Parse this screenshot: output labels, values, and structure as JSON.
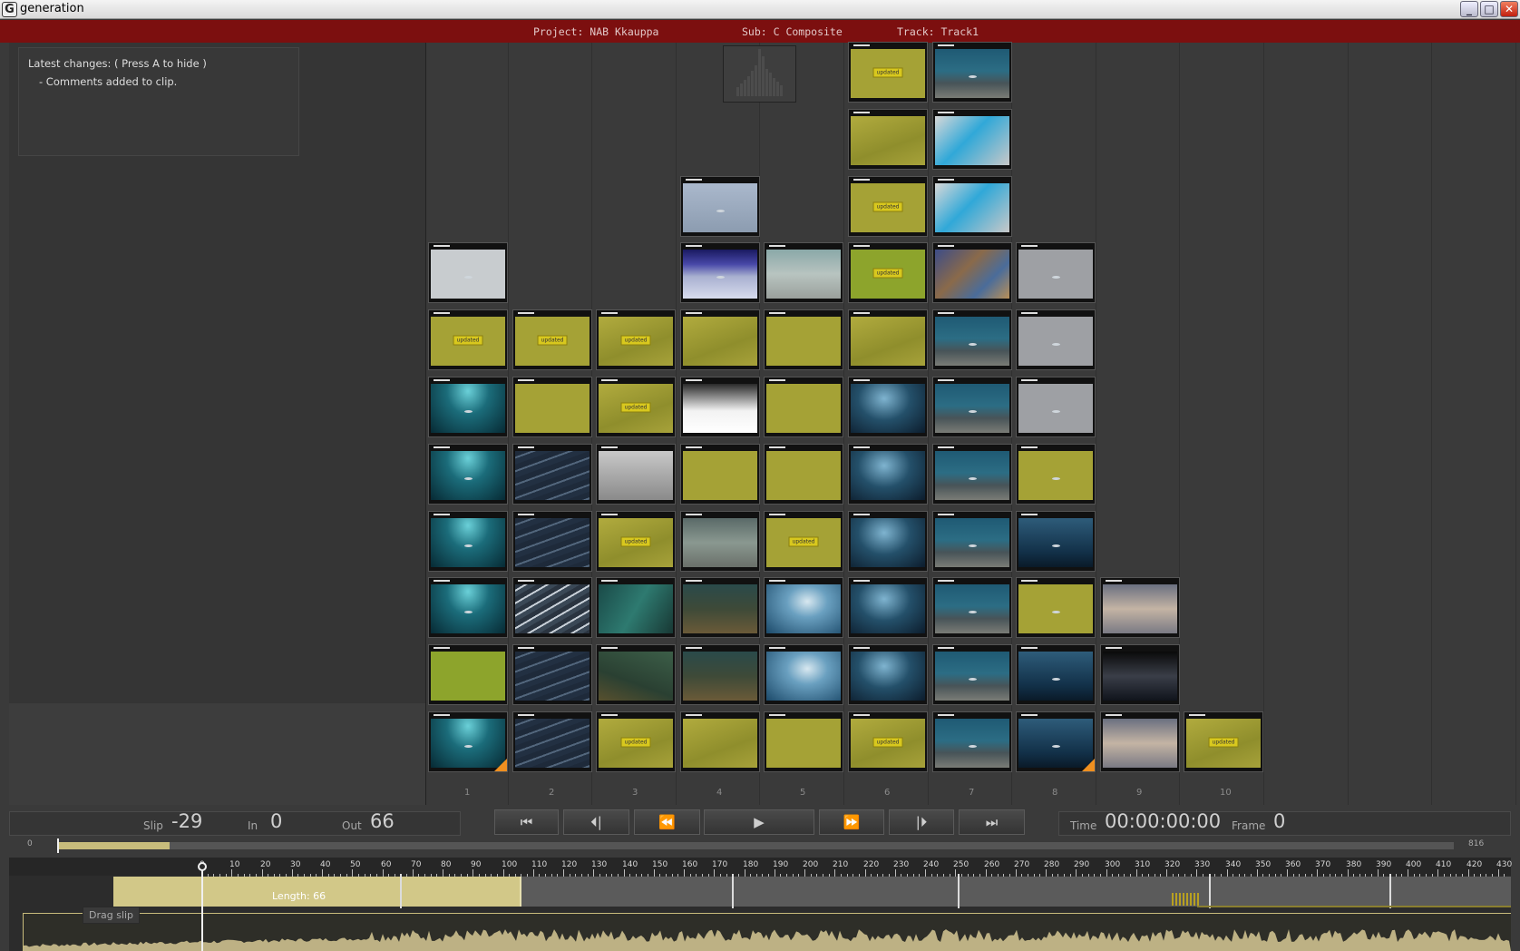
{
  "window": {
    "title": "generation",
    "app_icon": "G",
    "controls": [
      "_",
      "□",
      "✕"
    ]
  },
  "infobar": {
    "project": "Project: NAB Kkauppa",
    "sub": "Sub: C Composite",
    "track": "Track: Track1"
  },
  "changes": {
    "title": "Latest changes: ( Press A to hide )",
    "item": "- Comments added to clip."
  },
  "columns": [
    "1",
    "2",
    "3",
    "4",
    "5",
    "6",
    "7",
    "8",
    "9",
    "10"
  ],
  "clip_badge": "updated",
  "clips": [
    {
      "col": 6,
      "row": 0,
      "theme": "t-yellow",
      "updated": true
    },
    {
      "col": 7,
      "row": 0,
      "theme": "t-rock",
      "fish": true
    },
    {
      "col": 6,
      "row": 1,
      "theme": "t-yellow2"
    },
    {
      "col": 7,
      "row": 1,
      "theme": "t-cyan"
    },
    {
      "col": 4,
      "row": 2,
      "theme": "t-blueish",
      "fish": true
    },
    {
      "col": 6,
      "row": 2,
      "theme": "t-yellow",
      "updated": true
    },
    {
      "col": 7,
      "row": 2,
      "theme": "t-cyan"
    },
    {
      "col": 1,
      "row": 3,
      "theme": "t-lightgray",
      "fish": true
    },
    {
      "col": 4,
      "row": 3,
      "theme": "t-blue",
      "fish": true
    },
    {
      "col": 5,
      "row": 3,
      "theme": "t-mist"
    },
    {
      "col": 6,
      "row": 3,
      "theme": "t-green",
      "updated": true
    },
    {
      "col": 7,
      "row": 3,
      "theme": "t-colorful"
    },
    {
      "col": 8,
      "row": 3,
      "theme": "t-gray",
      "fish": true
    },
    {
      "col": 1,
      "row": 4,
      "theme": "t-yellow",
      "updated": true
    },
    {
      "col": 2,
      "row": 4,
      "theme": "t-yellow",
      "updated": true
    },
    {
      "col": 3,
      "row": 4,
      "theme": "t-yellow2",
      "updated": true
    },
    {
      "col": 4,
      "row": 4,
      "theme": "t-yellow2"
    },
    {
      "col": 5,
      "row": 4,
      "theme": "t-yellow"
    },
    {
      "col": 6,
      "row": 4,
      "theme": "t-yellow2"
    },
    {
      "col": 7,
      "row": 4,
      "theme": "t-rock",
      "fish": true
    },
    {
      "col": 8,
      "row": 4,
      "theme": "t-gray",
      "fish": true
    },
    {
      "col": 1,
      "row": 5,
      "theme": "t-under",
      "fish": true
    },
    {
      "col": 2,
      "row": 5,
      "theme": "t-yellow"
    },
    {
      "col": 3,
      "row": 5,
      "theme": "t-yellow2",
      "updated": true
    },
    {
      "col": 4,
      "row": 5,
      "theme": "t-snow"
    },
    {
      "col": 5,
      "row": 5,
      "theme": "t-yellow"
    },
    {
      "col": 6,
      "row": 5,
      "theme": "t-school"
    },
    {
      "col": 7,
      "row": 5,
      "theme": "t-rock",
      "fish": true
    },
    {
      "col": 8,
      "row": 5,
      "theme": "t-gray",
      "fish": true
    },
    {
      "col": 1,
      "row": 6,
      "theme": "t-under",
      "fish": true
    },
    {
      "col": 2,
      "row": 6,
      "theme": "t-sardine"
    },
    {
      "col": 3,
      "row": 6,
      "theme": "t-branches"
    },
    {
      "col": 4,
      "row": 6,
      "theme": "t-yellow"
    },
    {
      "col": 5,
      "row": 6,
      "theme": "t-yellow"
    },
    {
      "col": 6,
      "row": 6,
      "theme": "t-school"
    },
    {
      "col": 7,
      "row": 6,
      "theme": "t-rock",
      "fish": true
    },
    {
      "col": 8,
      "row": 6,
      "theme": "t-yellow",
      "fish": true
    },
    {
      "col": 1,
      "row": 7,
      "theme": "t-under",
      "fish": true
    },
    {
      "col": 2,
      "row": 7,
      "theme": "t-sardine"
    },
    {
      "col": 3,
      "row": 7,
      "theme": "t-yellow2",
      "updated": true
    },
    {
      "col": 4,
      "row": 7,
      "theme": "t-murky"
    },
    {
      "col": 5,
      "row": 7,
      "theme": "t-yellow",
      "updated": true
    },
    {
      "col": 6,
      "row": 7,
      "theme": "t-school"
    },
    {
      "col": 7,
      "row": 7,
      "theme": "t-rock",
      "fish": true
    },
    {
      "col": 8,
      "row": 7,
      "theme": "t-deep",
      "fish": true
    },
    {
      "col": 1,
      "row": 8,
      "theme": "t-under",
      "fish": true
    },
    {
      "col": 2,
      "row": 8,
      "theme": "t-sardine2"
    },
    {
      "col": 3,
      "row": 8,
      "theme": "t-kelp"
    },
    {
      "col": 4,
      "row": 8,
      "theme": "t-sand"
    },
    {
      "col": 5,
      "row": 8,
      "theme": "t-cloud"
    },
    {
      "col": 6,
      "row": 8,
      "theme": "t-school"
    },
    {
      "col": 7,
      "row": 8,
      "theme": "t-rock",
      "fish": true
    },
    {
      "col": 8,
      "row": 8,
      "theme": "t-yellow",
      "fish": true
    },
    {
      "col": 9,
      "row": 8,
      "theme": "t-face"
    },
    {
      "col": 1,
      "row": 9,
      "theme": "t-green"
    },
    {
      "col": 2,
      "row": 9,
      "theme": "t-sardine"
    },
    {
      "col": 3,
      "row": 9,
      "theme": "t-kelp2"
    },
    {
      "col": 4,
      "row": 9,
      "theme": "t-sand"
    },
    {
      "col": 5,
      "row": 9,
      "theme": "t-cloud"
    },
    {
      "col": 6,
      "row": 9,
      "theme": "t-school"
    },
    {
      "col": 7,
      "row": 9,
      "theme": "t-rock",
      "fish": true
    },
    {
      "col": 8,
      "row": 9,
      "theme": "t-deep",
      "fish": true
    },
    {
      "col": 9,
      "row": 9,
      "theme": "t-street"
    },
    {
      "col": 1,
      "row": 10,
      "theme": "t-under",
      "fish": true,
      "corner": true
    },
    {
      "col": 2,
      "row": 10,
      "theme": "t-sardine"
    },
    {
      "col": 3,
      "row": 10,
      "theme": "t-yellow2",
      "updated": true
    },
    {
      "col": 4,
      "row": 10,
      "theme": "t-yellow2"
    },
    {
      "col": 5,
      "row": 10,
      "theme": "t-yellow"
    },
    {
      "col": 6,
      "row": 10,
      "theme": "t-yellow2",
      "updated": true
    },
    {
      "col": 7,
      "row": 10,
      "theme": "t-rock",
      "fish": true
    },
    {
      "col": 8,
      "row": 10,
      "theme": "t-deep",
      "fish": true,
      "corner": true
    },
    {
      "col": 9,
      "row": 10,
      "theme": "t-face"
    },
    {
      "col": 10,
      "row": 10,
      "theme": "t-yellow2",
      "updated": true
    }
  ],
  "controls": {
    "slip_label": "Slip",
    "slip_value": "-29",
    "in_label": "In",
    "in_value": "0",
    "out_label": "Out",
    "out_value": "66",
    "time_label": "Time",
    "time_value": "00:00:00:00",
    "frame_label": "Frame",
    "frame_value": "0",
    "transport": {
      "first": "⏮",
      "prev_frame": "⏴|",
      "rewind": "⏪",
      "play": "▶",
      "forward": "⏩",
      "next_frame": "|⏵",
      "last": "⏭"
    }
  },
  "scrub": {
    "start": "0",
    "end": "816",
    "position_fraction": 0.08
  },
  "timeline": {
    "ruler": [
      "0",
      "10",
      "20",
      "30",
      "40",
      "50",
      "60",
      "70",
      "80",
      "90",
      "100",
      "110",
      "120",
      "130",
      "140",
      "150",
      "160",
      "170",
      "180",
      "190",
      "200",
      "210",
      "220",
      "230",
      "240",
      "250",
      "260",
      "270",
      "280",
      "290",
      "300",
      "310",
      "320",
      "330",
      "340",
      "350",
      "360",
      "370",
      "380",
      "390",
      "400",
      "410",
      "420",
      "430"
    ],
    "clip_label": "Length: 66",
    "drag_slip": "Drag slip"
  }
}
